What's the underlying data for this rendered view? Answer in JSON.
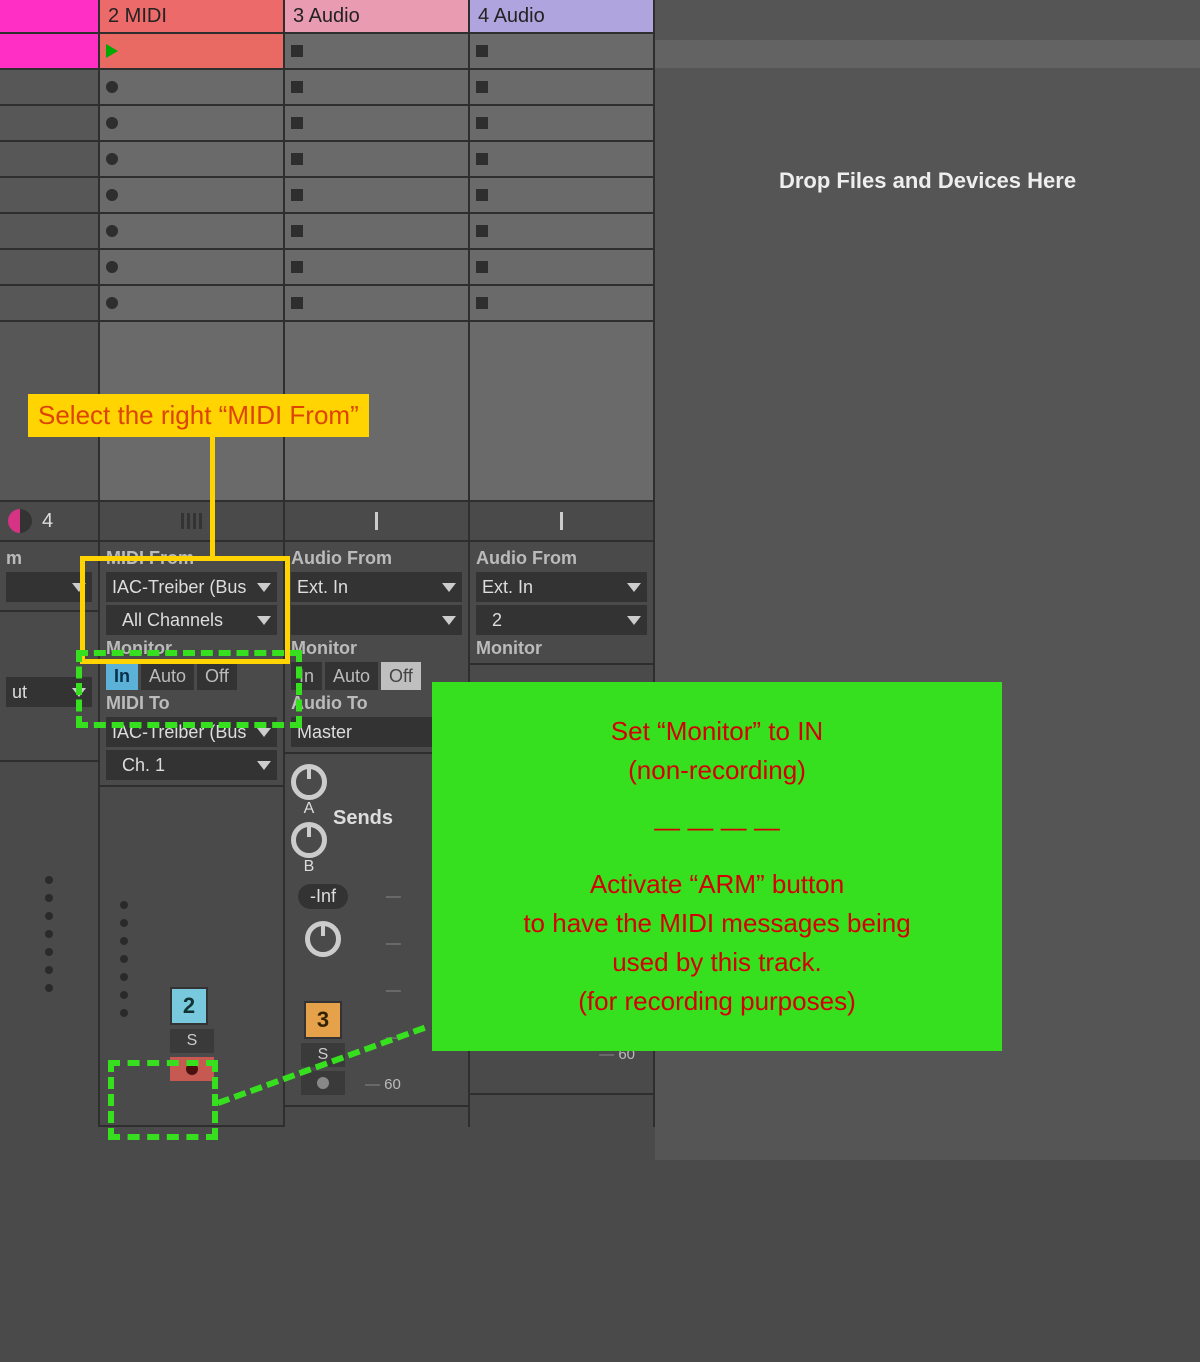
{
  "dropzone": {
    "message": "Drop Files and Devices Here"
  },
  "tracks": {
    "t0": {
      "count": "4"
    },
    "t1": {
      "name": "2 MIDI",
      "io_from_label": "MIDI From",
      "io_from_value": "IAC-Treiber (Bus",
      "io_from_chan": "All Channels",
      "monitor_label": "Monitor",
      "mon_in": "In",
      "mon_auto": "Auto",
      "mon_off": "Off",
      "io_to_label": "MIDI To",
      "io_to_value": "IAC-Treiber (Bus",
      "io_to_chan": "Ch. 1",
      "num": "2",
      "s": "S"
    },
    "t2": {
      "name": "3 Audio",
      "io_from_label": "Audio From",
      "io_from_value": "Ext. In",
      "io_from_chan": "",
      "monitor_label": "Monitor",
      "mon_in": "In",
      "mon_auto": "Auto",
      "mon_off": "Off",
      "io_to_label": "Audio To",
      "io_to_value": "Master",
      "sends": "Sends",
      "send_a": "A",
      "send_b": "B",
      "vol": "-Inf",
      "num": "3",
      "s": "S",
      "scale_60": "60"
    },
    "t3": {
      "name": "4 Audio",
      "io_from_label": "Audio From",
      "io_from_value": "Ext. In",
      "io_from_chan": "2",
      "monitor_label": "Monitor",
      "scale_60": "60"
    }
  },
  "left": {
    "out": "ut"
  },
  "annotations": {
    "yellow_label": "Select the right “MIDI From”",
    "green_line1": "Set “Monitor” to IN",
    "green_line2": "(non-recording)",
    "green_line3": "— — — —",
    "green_line4": "Activate “ARM” button",
    "green_line5": "to have the MIDI messages being",
    "green_line6": "used by this track.",
    "green_line7": "(for recording purposes)"
  }
}
